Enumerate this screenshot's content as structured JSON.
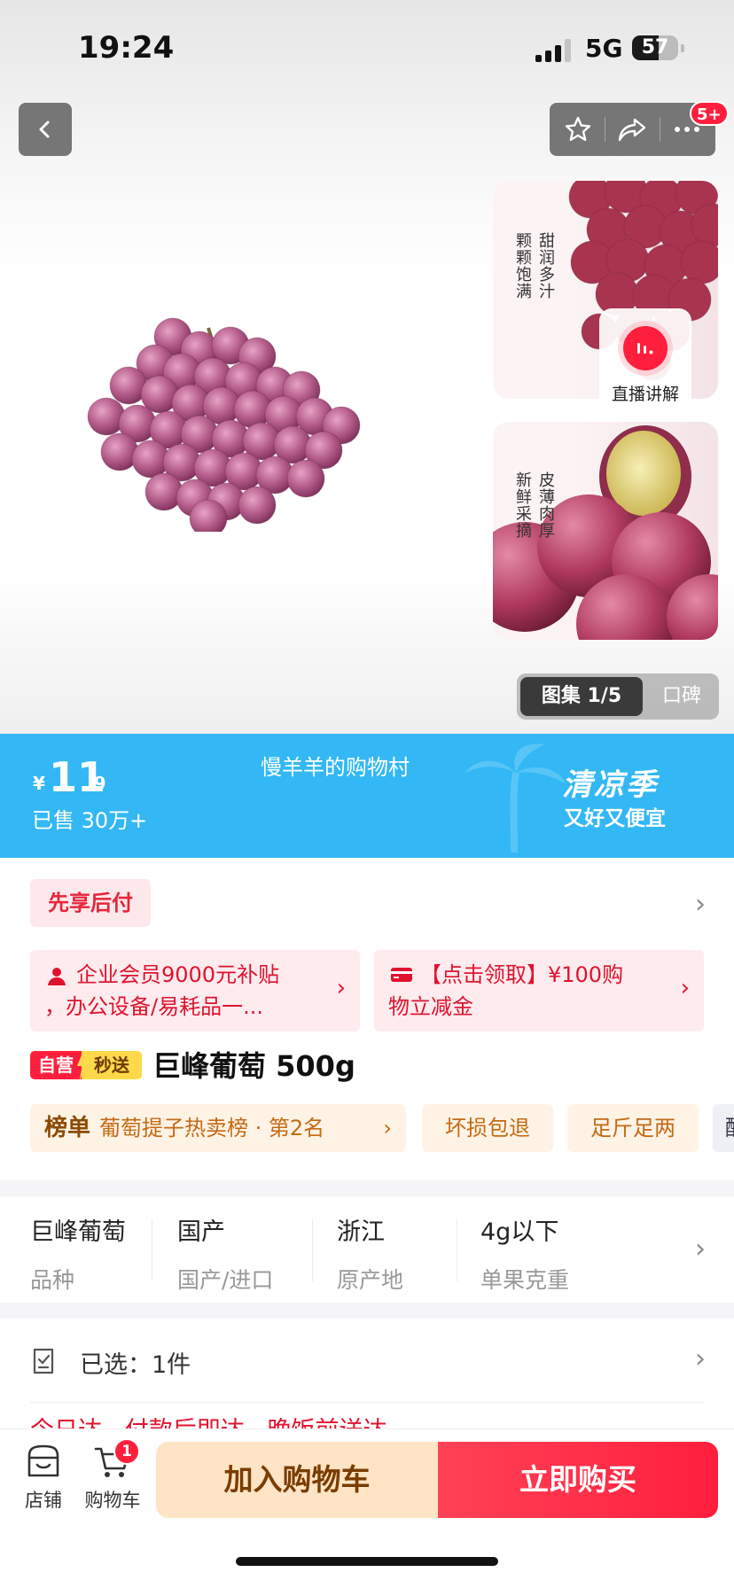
{
  "status_bar": {
    "time": "19:24",
    "network": "5G",
    "battery": "57",
    "battery_level": 0.57
  },
  "top_actions": {
    "more_badge": "5+",
    "icons": [
      "back-icon",
      "star-icon",
      "share-icon",
      "more-icon"
    ]
  },
  "gallery": {
    "thumbs": [
      {
        "caption_right": "甜润多汁",
        "caption_left": "颗颗饱满"
      },
      {
        "caption_right": "皮薄肉厚",
        "caption_left": "新鲜采摘"
      }
    ],
    "live_label": "直播讲解",
    "tab_active": "图集 1/5",
    "tab_other": "口碑"
  },
  "promo_band": {
    "currency": "¥",
    "price_int": "11",
    "price_dec": ".9",
    "sold": "已售 30万+",
    "shop_name": "慢羊羊的购物村",
    "season": "清凉季",
    "slogan": "又好又便宜"
  },
  "pay_later": {
    "label": "先享后付",
    "chevron": "›"
  },
  "coupons": [
    {
      "line1": "企业会员9000元补贴",
      "line2": "，办公设备/易耗品一...",
      "chevron": "›"
    },
    {
      "line1": "【点击领取】¥100购",
      "line2": "物立减金",
      "chevron": "›"
    }
  ],
  "product": {
    "tag_self": "自营",
    "tag_fast": "秒送",
    "title": "巨峰葡萄 500g"
  },
  "highlights": {
    "rank_label": "榜单",
    "rank_text": "葡萄提子热卖榜 · 第2名",
    "rank_chevron": "›",
    "tags": [
      "坏损包退",
      "足斤足两",
      "酸"
    ]
  },
  "attributes": [
    {
      "value": "巨峰葡萄",
      "label": "品种"
    },
    {
      "value": "国产",
      "label": "国产/进口"
    },
    {
      "value": "浙江",
      "label": "原产地"
    },
    {
      "value": "4g以下",
      "label": "单果克重"
    }
  ],
  "attributes_chevron": "›",
  "selection": {
    "text": "已选：1件",
    "chevron": "›",
    "next_row_partial": "今日达 · 付款后即达 · 晚饭前送达"
  },
  "bottom_bar": {
    "store_label": "店铺",
    "cart_label": "购物车",
    "cart_badge": "1",
    "add_to_cart": "加入购物车",
    "buy_now": "立即购买"
  },
  "colors": {
    "accent_red": "#ff1f3d",
    "band_blue": "#33b8f5",
    "cart_button_bg": "#ffe4c5"
  }
}
